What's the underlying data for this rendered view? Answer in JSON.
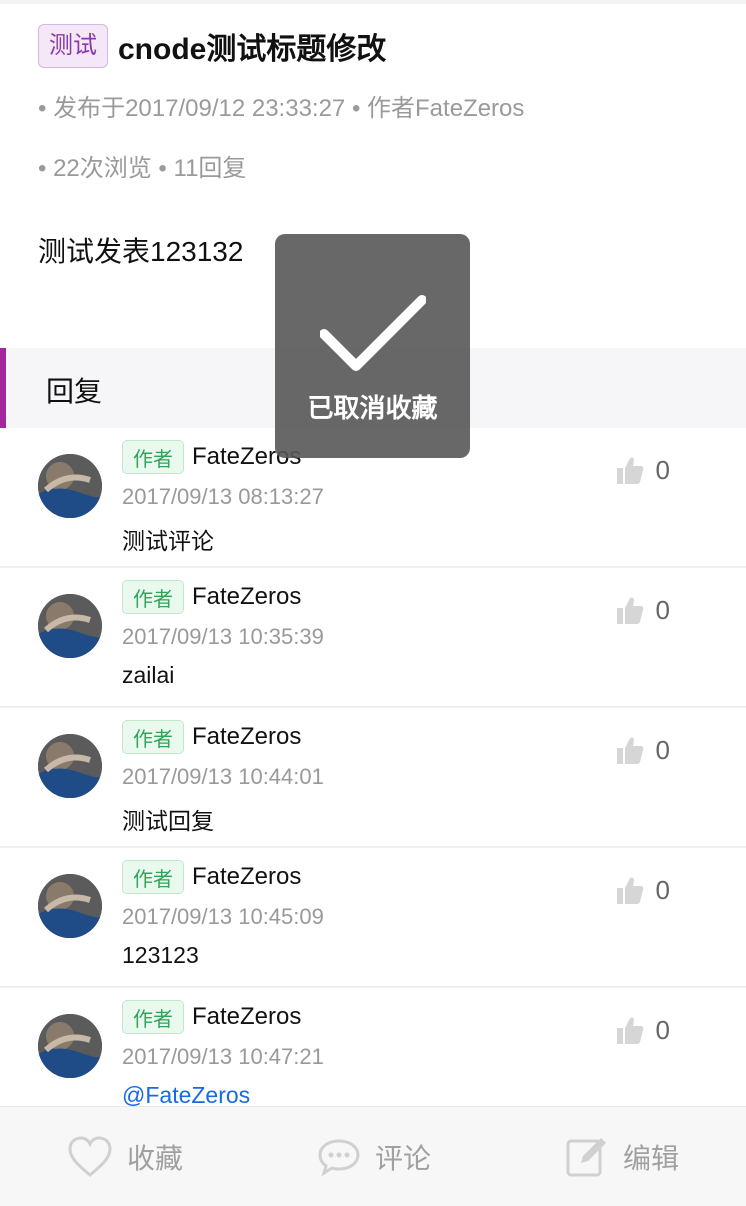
{
  "topic": {
    "tag": "测试",
    "title": "cnode测试标题修改",
    "published": "• 发布于2017/09/12 23:33:27 • 作者FateZeros",
    "stats": "• 22次浏览 • 11回复",
    "content": "测试发表123132"
  },
  "replies_section": {
    "label": "回复"
  },
  "replies": [
    {
      "tag": "作者",
      "author": "FateZeros",
      "time": "2017/09/13 08:13:27",
      "text": "测试评论",
      "likes": "0"
    },
    {
      "tag": "作者",
      "author": "FateZeros",
      "time": "2017/09/13 10:35:39",
      "text": "zailai",
      "likes": "0"
    },
    {
      "tag": "作者",
      "author": "FateZeros",
      "time": "2017/09/13 10:44:01",
      "text": "测试回复",
      "likes": "0"
    },
    {
      "tag": "作者",
      "author": "FateZeros",
      "time": "2017/09/13 10:45:09",
      "text": "123123",
      "likes": "0"
    },
    {
      "tag": "作者",
      "author": "FateZeros",
      "time": "2017/09/13 10:47:21",
      "text": "@FateZeros",
      "likes": "0"
    }
  ],
  "toast": {
    "message": "已取消收藏",
    "icon": "checkmark-icon"
  },
  "bottom_bar": {
    "favorite_label": "收藏",
    "comment_label": "评论",
    "edit_label": "编辑"
  },
  "colors": {
    "accent": "#a3279c",
    "author_tag": "#2fa55a",
    "link": "#1769e6"
  }
}
